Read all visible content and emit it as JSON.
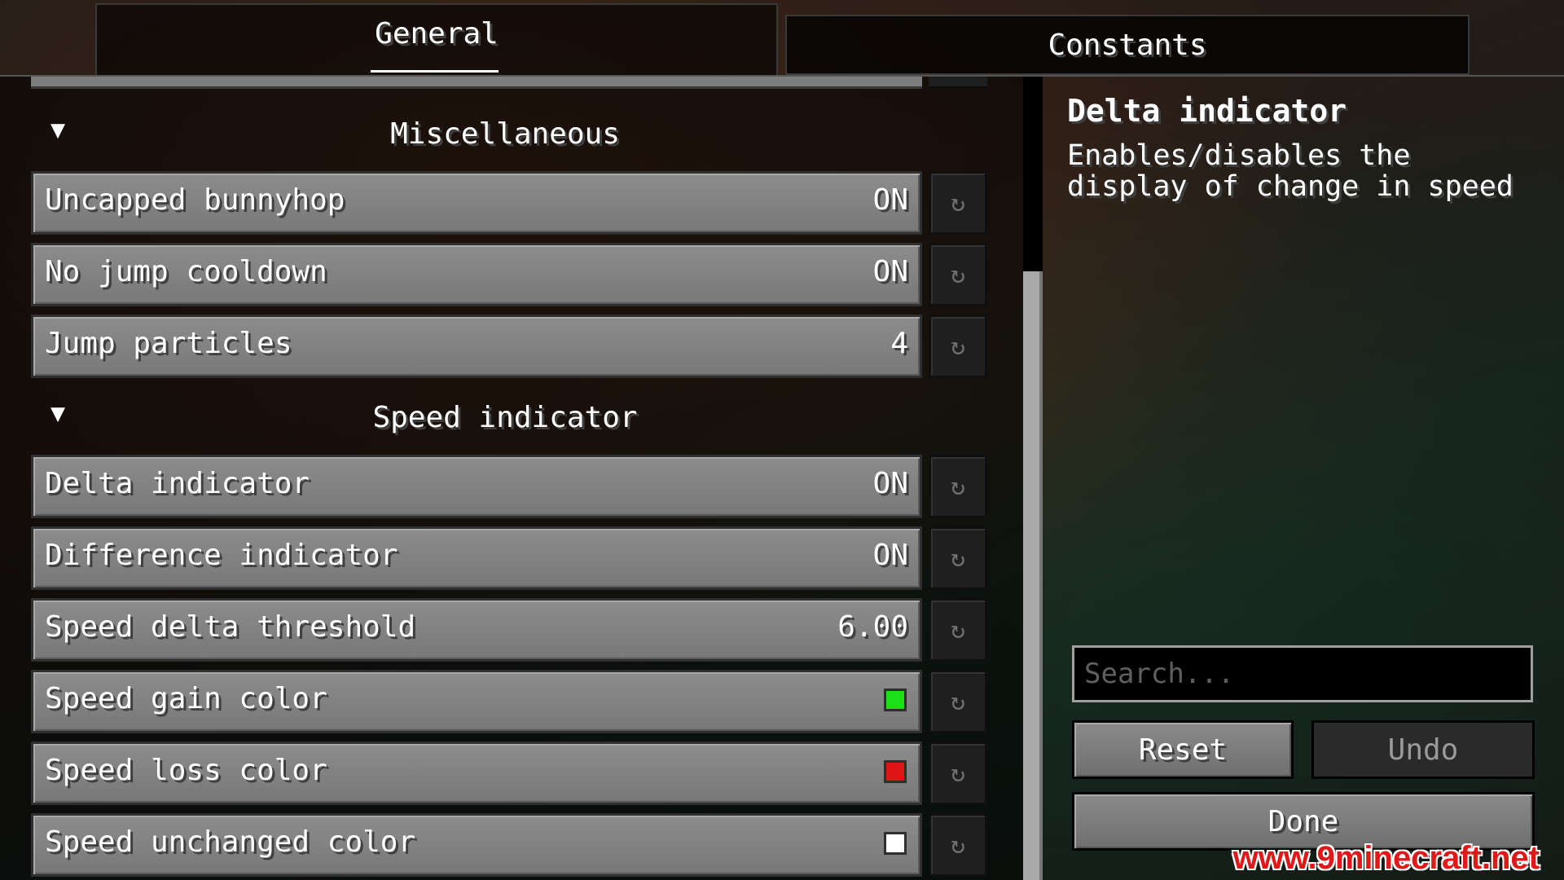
{
  "tabs": [
    {
      "label": "General",
      "active": true
    },
    {
      "label": "Constants",
      "active": false
    }
  ],
  "categories": [
    {
      "label": "Miscellaneous",
      "arrow": "▼"
    },
    {
      "label": "Speed indicator",
      "arrow": "▼"
    }
  ],
  "options": [
    {
      "name": "Uncapped bunnyhop",
      "value": "ON"
    },
    {
      "name": "No jump cooldown",
      "value": "ON"
    },
    {
      "name": "Jump particles",
      "value": "4"
    },
    {
      "name": "Delta indicator",
      "value": "ON"
    },
    {
      "name": "Difference indicator",
      "value": "ON"
    },
    {
      "name": "Speed delta threshold",
      "value": "6.00"
    },
    {
      "name": "Speed gain color",
      "color": "#19e019"
    },
    {
      "name": "Speed loss color",
      "color": "#e01414"
    },
    {
      "name": "Speed unchanged color",
      "color": "#ffffff"
    }
  ],
  "reset_icon": "↻",
  "description": {
    "title": "Delta indicator",
    "text": "Enables/disables the display of change in speed"
  },
  "search": {
    "placeholder": "Search..."
  },
  "buttons": {
    "reset": "Reset",
    "undo": "Undo",
    "done": "Done"
  },
  "watermark": "www.9minecraft.net"
}
